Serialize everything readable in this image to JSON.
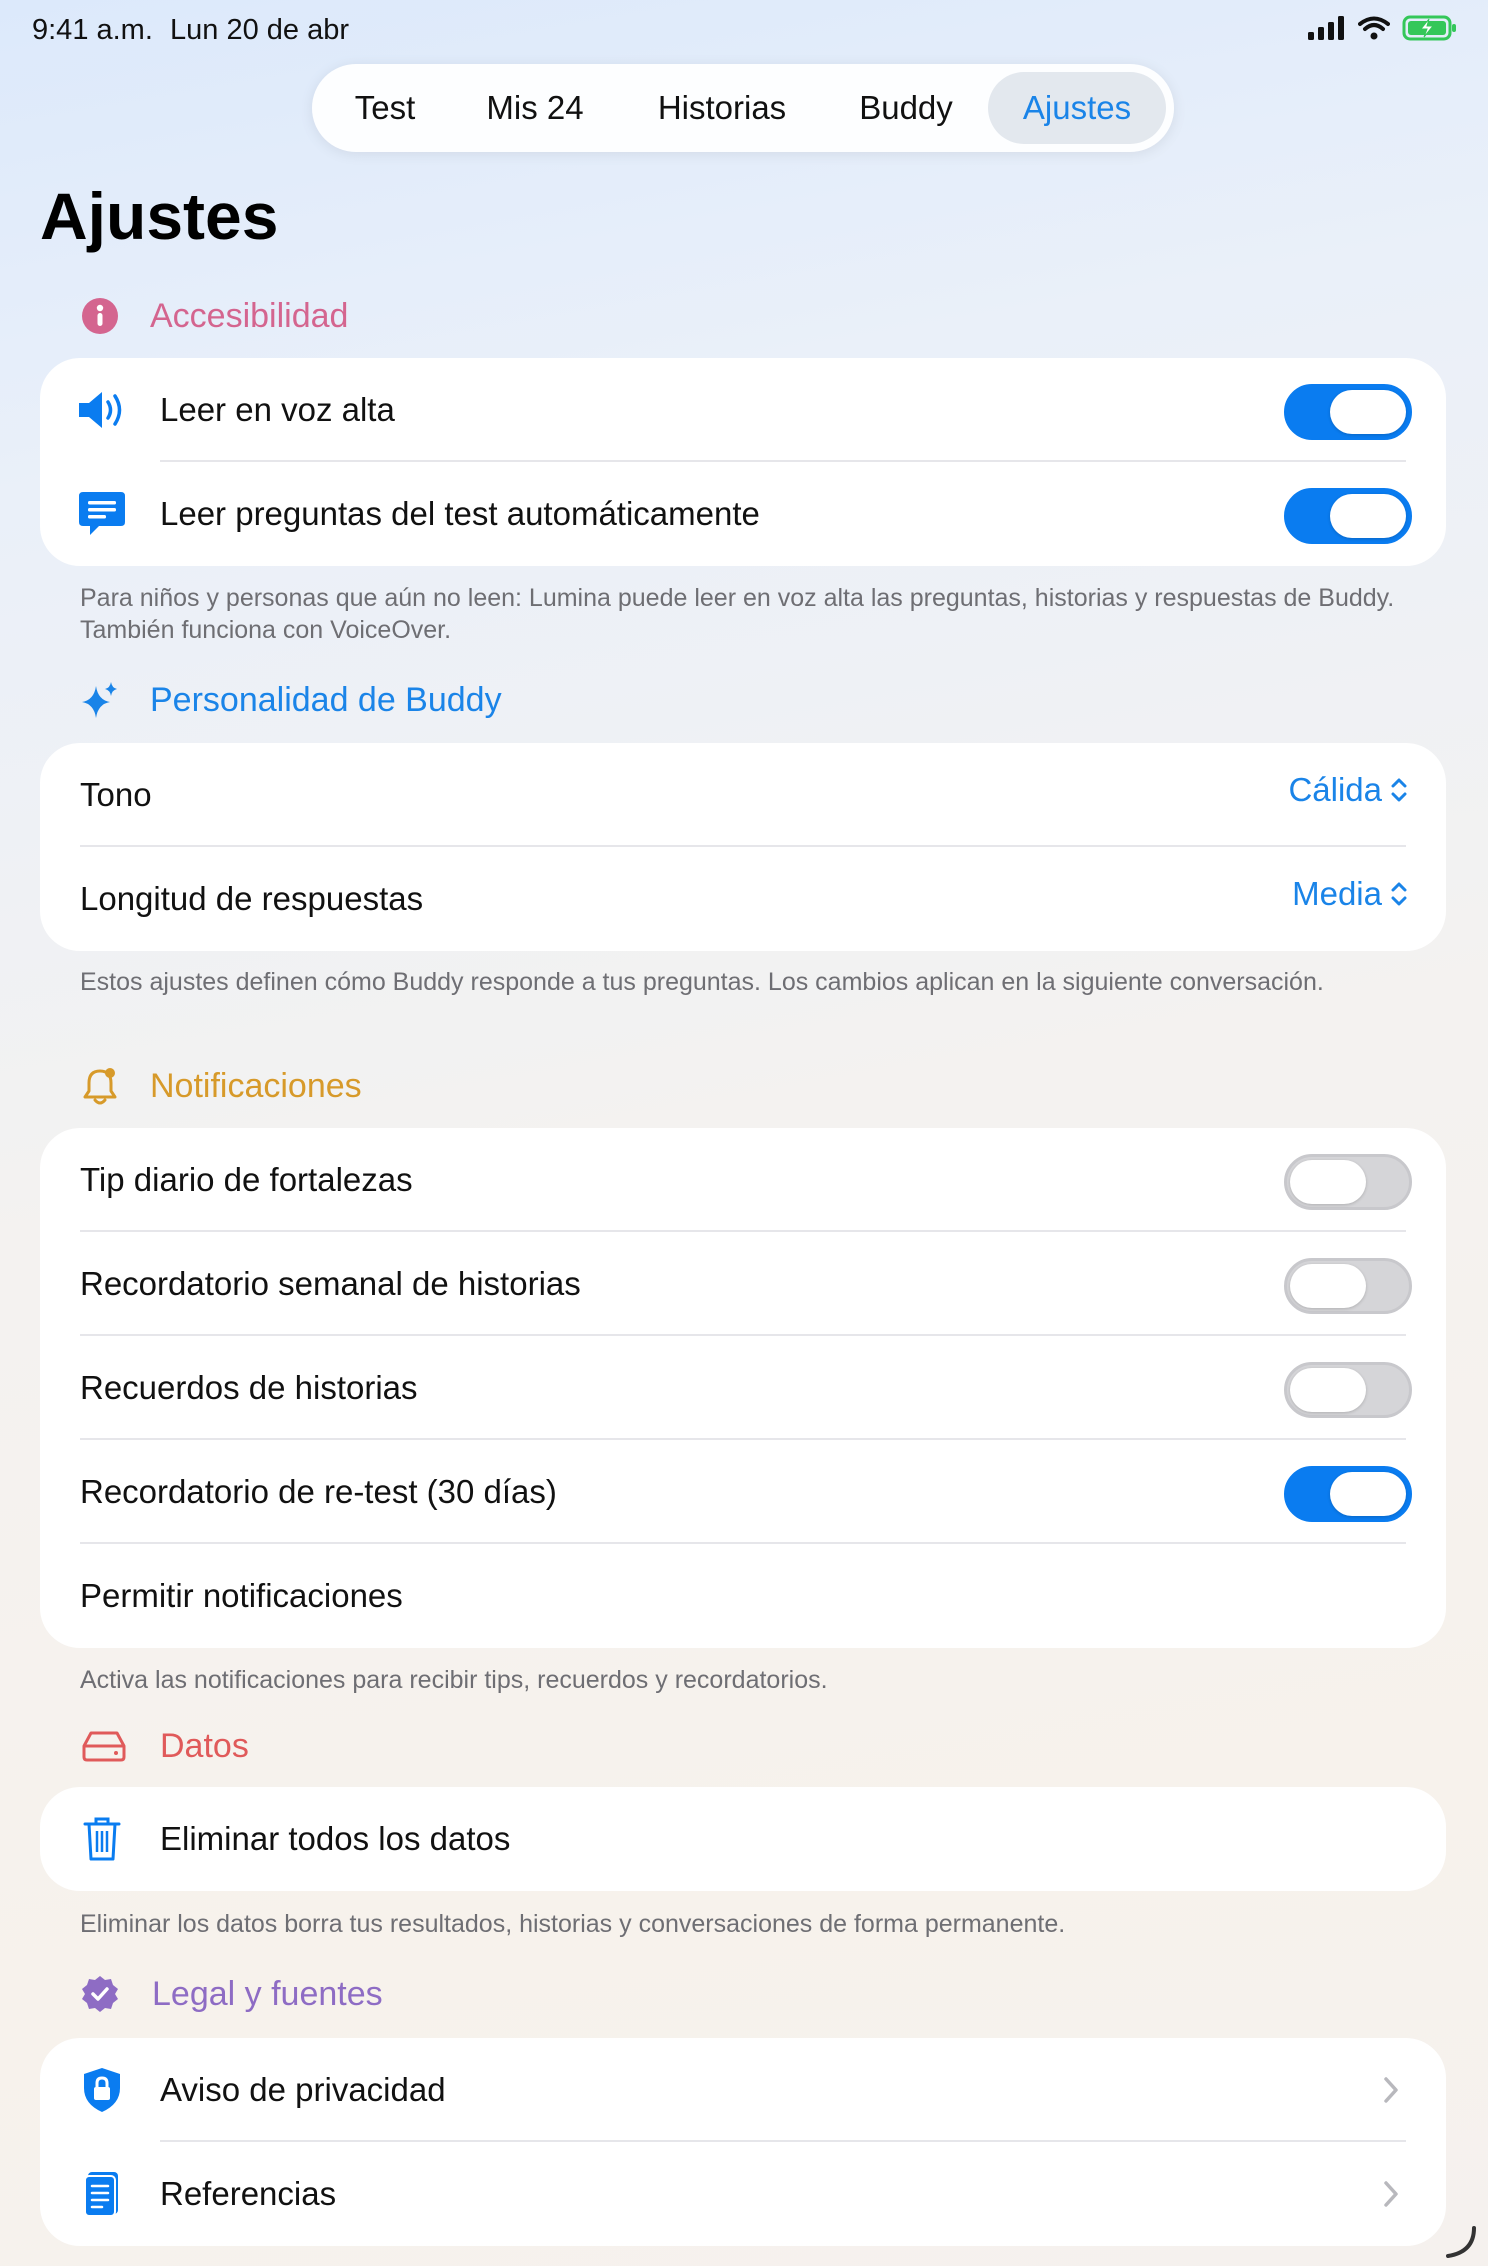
{
  "status": {
    "time": "9:41 a.m.",
    "date": "Lun 20 de abr"
  },
  "tabs": [
    {
      "label": "Test"
    },
    {
      "label": "Mis 24"
    },
    {
      "label": "Historias"
    },
    {
      "label": "Buddy"
    },
    {
      "label": "Ajustes",
      "active": true
    }
  ],
  "title": "Ajustes",
  "accessibility": {
    "heading": "Accesibilidad",
    "icon": "accessibility-icon",
    "color": "#d4658f",
    "rows": [
      {
        "label": "Leer en voz alta",
        "icon": "speaker-icon",
        "on": true
      },
      {
        "label": "Leer preguntas del test automáticamente",
        "icon": "message-icon",
        "on": true
      }
    ],
    "footnote": "Para niños y personas que aún no leen: Lumina puede leer en voz alta las preguntas, historias y respuestas de Buddy. También funciona con VoiceOver."
  },
  "personality": {
    "heading": "Personalidad de Buddy",
    "icon": "sparkles-icon",
    "color": "#1a84e8",
    "rows": [
      {
        "label": "Tono",
        "value": "Cálida"
      },
      {
        "label": "Longitud de respuestas",
        "value": "Media"
      }
    ],
    "footnote": "Estos ajustes definen cómo Buddy responde a tus preguntas. Los cambios aplican en la siguiente conversación."
  },
  "notifications": {
    "heading": "Notificaciones",
    "icon": "bell-icon",
    "color": "#d79a2a",
    "rows": [
      {
        "label": "Tip diario de fortalezas",
        "on": false
      },
      {
        "label": "Recordatorio semanal de historias",
        "on": false
      },
      {
        "label": "Recuerdos de historias",
        "on": false
      },
      {
        "label": "Recordatorio de re-test (30 días)",
        "on": true
      }
    ],
    "allow_label": "Permitir notificaciones",
    "footnote": "Activa las notificaciones para recibir tips, recuerdos y recordatorios."
  },
  "data": {
    "heading": "Datos",
    "icon": "drive-icon",
    "color": "#e05a5a",
    "delete_label": "Eliminar todos los datos",
    "footnote": "Eliminar los datos borra tus resultados, historias y conversaciones de forma permanente."
  },
  "legal": {
    "heading": "Legal y fuentes",
    "icon": "checkmark-seal-icon",
    "color": "#8e6cc4",
    "rows": [
      {
        "label": "Aviso de privacidad",
        "icon": "shield-lock-icon"
      },
      {
        "label": "Referencias",
        "icon": "document-icon"
      }
    ]
  },
  "colors": {
    "accent": "#1a84e8",
    "toggle_on": "#0a7cf0",
    "danger": "#e5373b"
  }
}
